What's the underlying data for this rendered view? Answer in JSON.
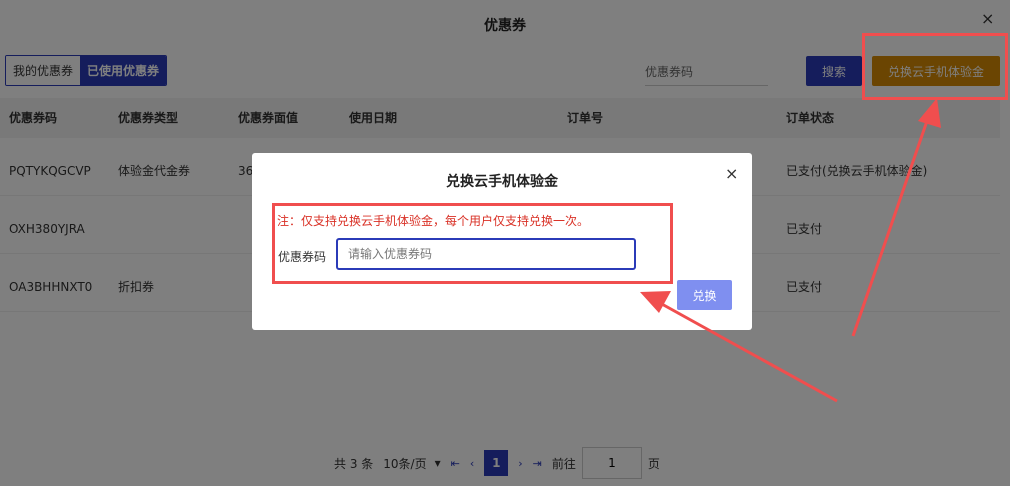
{
  "page": {
    "title": "优惠券",
    "close_icon": "×",
    "tabs": [
      {
        "label": "我的优惠券"
      },
      {
        "label": "已使用优惠券"
      }
    ],
    "search": {
      "placeholder": "优惠券码",
      "value": ""
    },
    "search_button": "搜索",
    "redeem_button": "兑换云手机体验金"
  },
  "table": {
    "headers": [
      "优惠券码",
      "优惠券类型",
      "优惠券面值",
      "使用日期",
      "订单号",
      "订单状态"
    ],
    "rows": [
      {
        "code": "PQTYKQGCVP",
        "type": "体验金代金券",
        "value": "36",
        "date": "",
        "order": "",
        "status": "已支付(兑换云手机体验金)"
      },
      {
        "code": "OXH380YJRA",
        "type": "",
        "value": "",
        "date": "",
        "order": "",
        "status": "已支付"
      },
      {
        "code": "OA3BHHNXT0",
        "type": "折扣券",
        "value": "",
        "date": "",
        "order": "",
        "status": "已支付"
      }
    ]
  },
  "pagination": {
    "total": "共 3 条",
    "page_size": "10条/页",
    "current": "1",
    "goto_label": "前往",
    "goto_value": "1",
    "page_unit": "页",
    "dropdown_icon": "▾",
    "first_icon": "⇤",
    "prev_icon": "‹",
    "next_icon": "›",
    "last_icon": "⇥"
  },
  "modal": {
    "title": "兑换云手机体验金",
    "close_icon": "×",
    "note": "注：仅支持兑换云手机体验金，每个用户仅支持兑换一次。",
    "field_label": "优惠券码",
    "input_placeholder": "请输入优惠券码",
    "input_value": "",
    "submit_button": "兑换"
  },
  "colors": {
    "primary": "#2b3bb8",
    "accent_orange": "#d68a05",
    "annotation_red": "#f04e4e",
    "note_red": "#d93025"
  }
}
